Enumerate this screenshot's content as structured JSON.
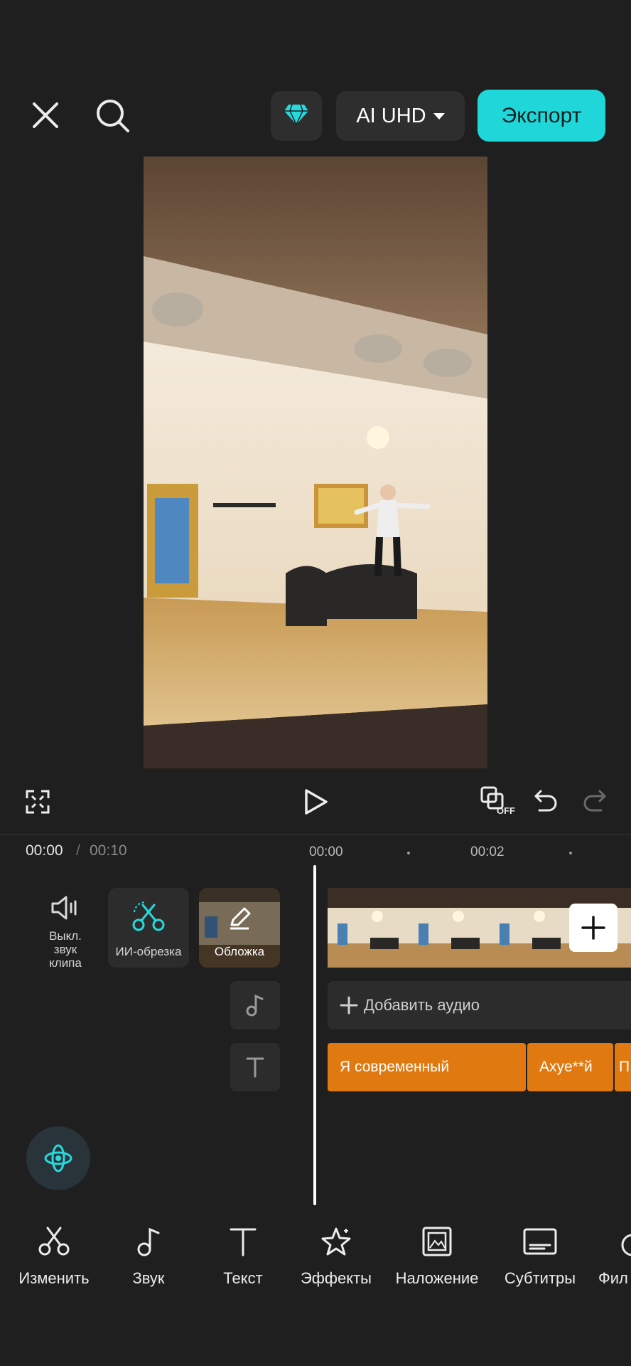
{
  "topbar": {
    "close_icon": "close-icon",
    "search_icon": "search-icon",
    "pro_icon": "diamond-icon",
    "quality_label": "AI UHD",
    "export_label": "Экспорт",
    "accent_color": "#1fd6d9"
  },
  "player": {
    "fullscreen_icon": "fullscreen-icon",
    "play_icon": "play-icon",
    "keyframe_off_icon": "keyframe-off-icon",
    "keyframe_off_badge": "OFF",
    "undo_icon": "undo-icon",
    "redo_icon": "redo-icon"
  },
  "timeline": {
    "current_time": "00:00",
    "separator": "/",
    "total_time": "00:10",
    "ruler": [
      "00:00",
      "00:02"
    ],
    "mute_label": "Выкл.\nзвук\nклипа",
    "ai_trim_label": "ИИ-обрезка",
    "cover_label": "Обложка",
    "add_audio_label": "Добавить аудио",
    "text_clips": [
      "Я современный",
      "Axye**й",
      "П"
    ],
    "text_clip_color": "#e07a10"
  },
  "assistant_icon": "ai-assistant-icon",
  "toolbar": {
    "items": [
      {
        "label": "Изменить",
        "icon": "scissors-icon"
      },
      {
        "label": "Звук",
        "icon": "music-note-icon"
      },
      {
        "label": "Текст",
        "icon": "text-icon"
      },
      {
        "label": "Эффекты",
        "icon": "sparkle-star-icon"
      },
      {
        "label": "Наложение",
        "icon": "overlay-icon"
      },
      {
        "label": "Субтитры",
        "icon": "subtitles-icon"
      },
      {
        "label": "Фил",
        "icon": "filter-icon"
      }
    ]
  }
}
